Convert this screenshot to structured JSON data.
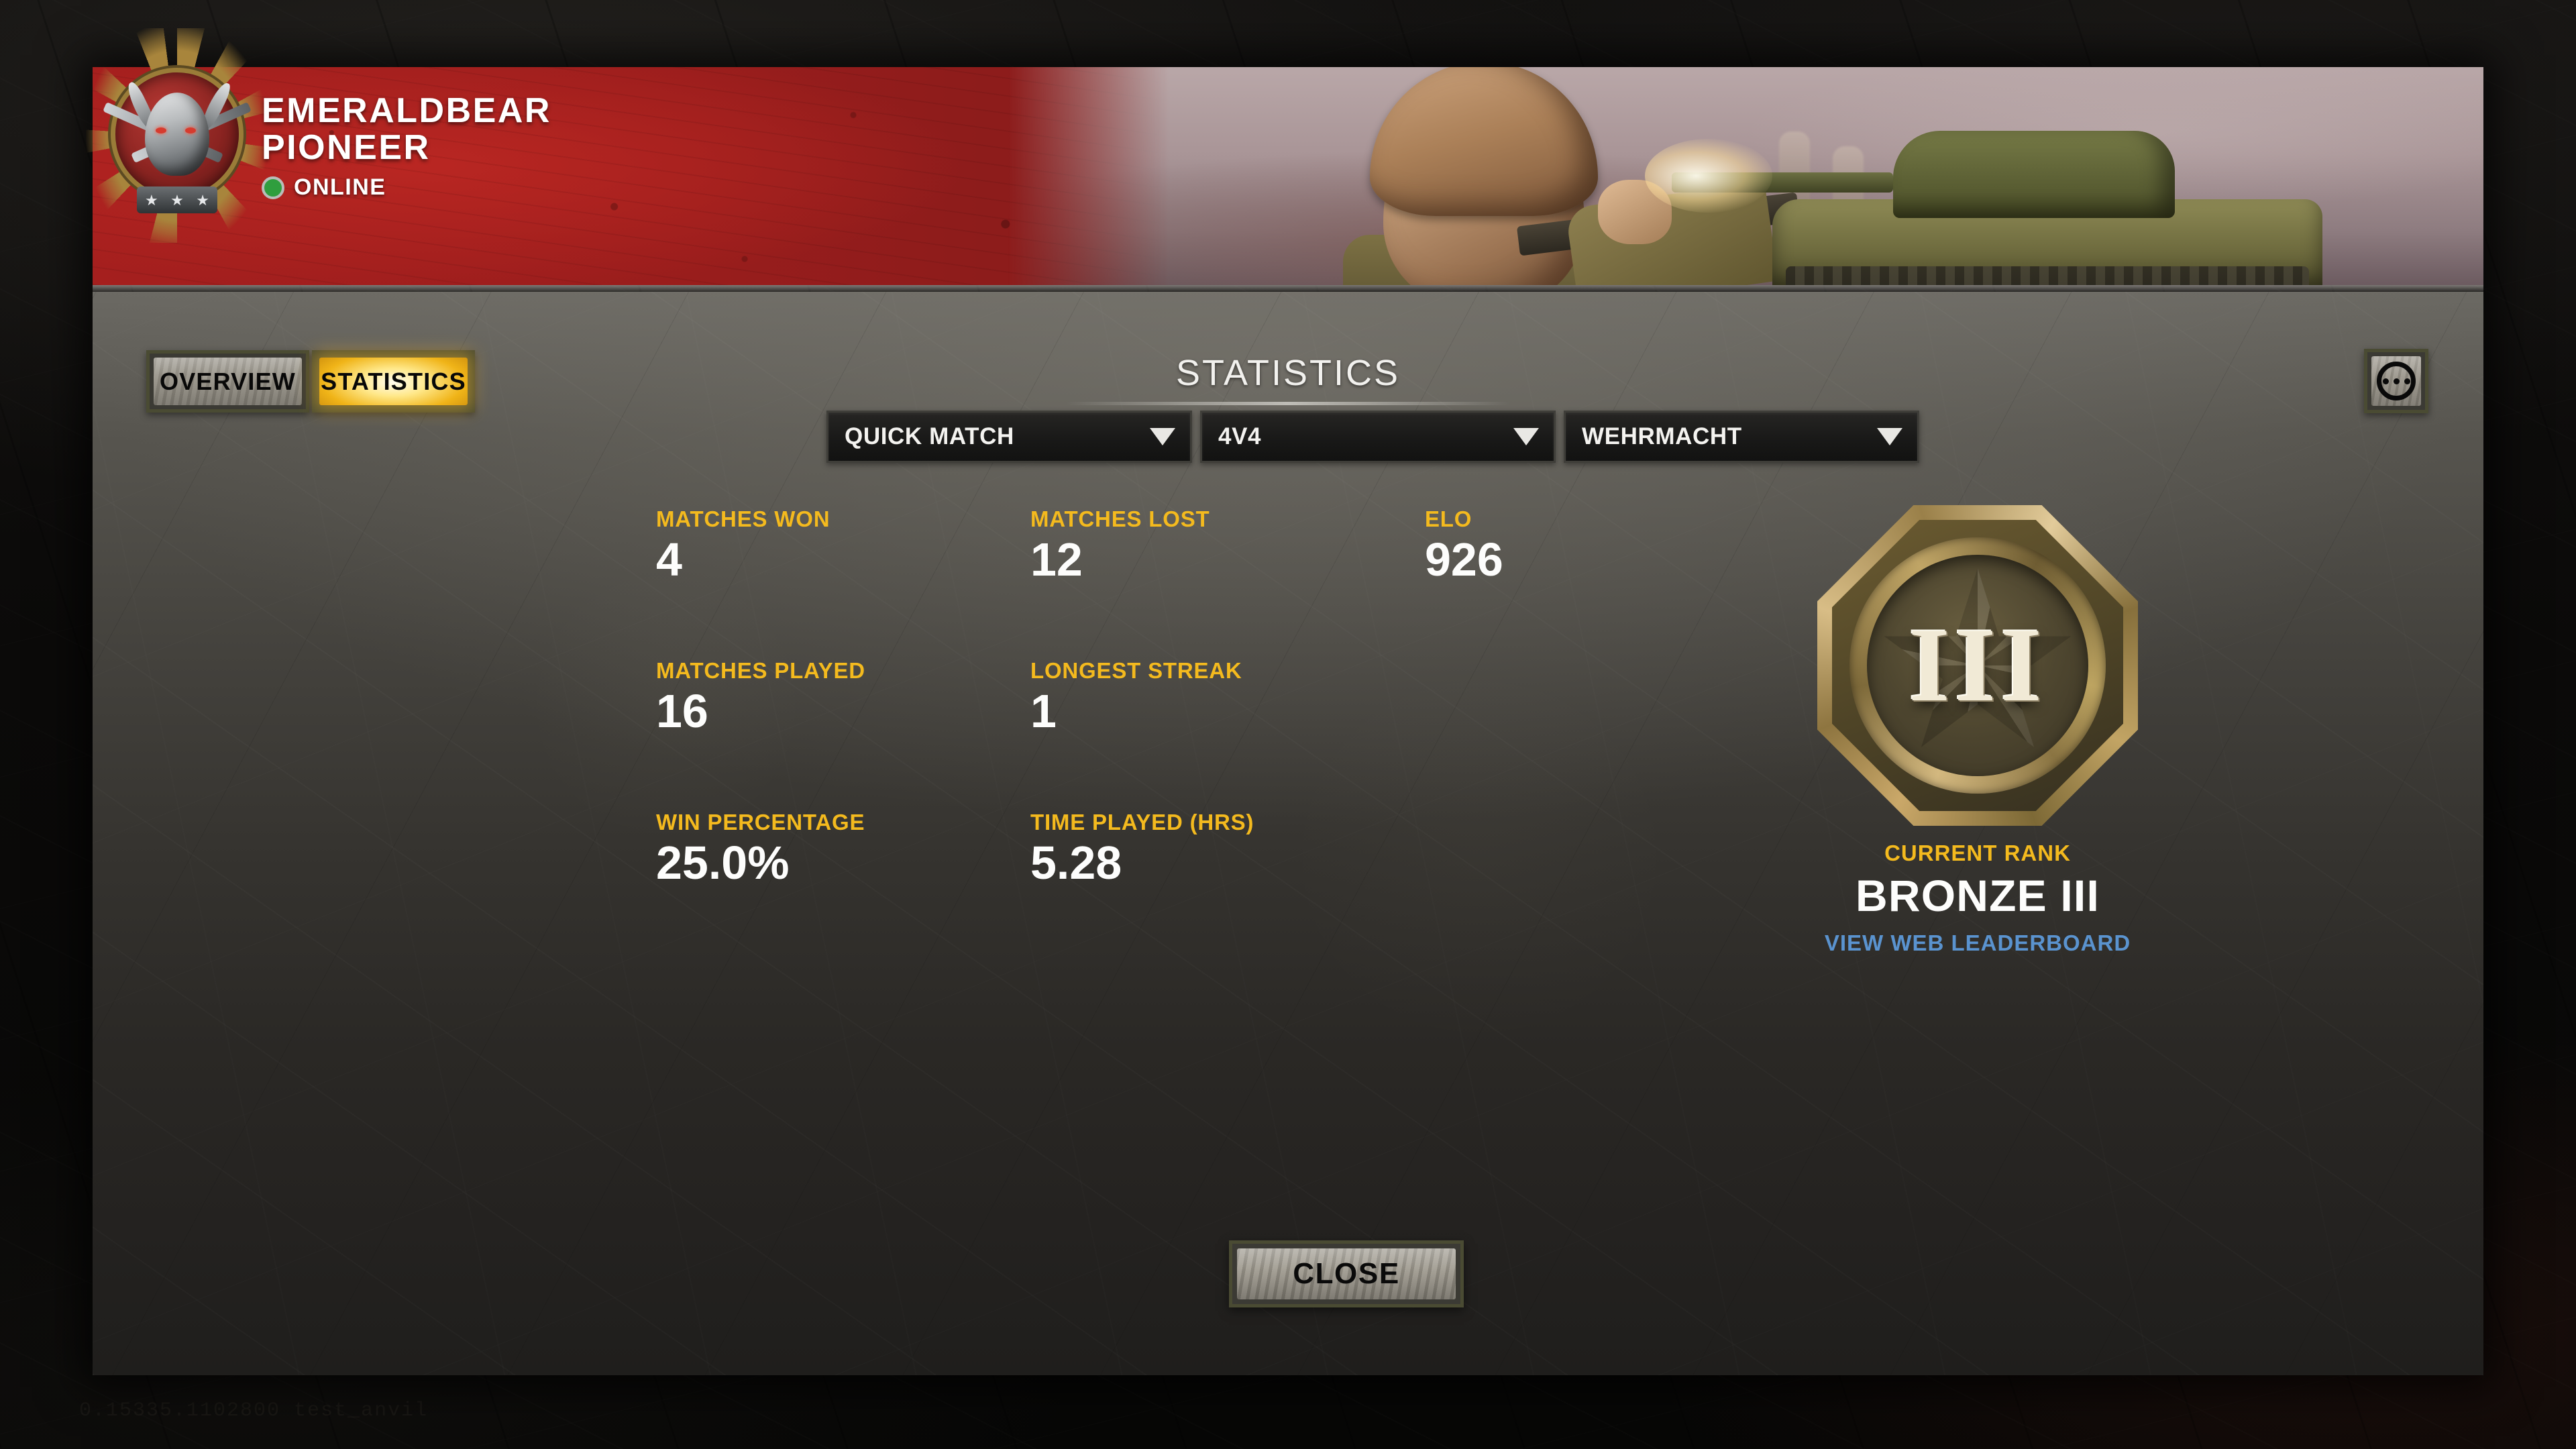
{
  "build_string": "0.15335.1102800 test_anvil",
  "profile": {
    "player_name": "EMERALDBEAR",
    "player_suffix": "PIONEER",
    "status_label": "ONLINE",
    "status_color": "#2f9e3e",
    "avatar_icon": "demon-skull-crossed-blades-emblem"
  },
  "tabs": [
    {
      "label": "OVERVIEW",
      "active": false
    },
    {
      "label": "STATISTICS",
      "active": true
    }
  ],
  "header": {
    "section_title": "STATISTICS",
    "options_button_icon": "more-options-icon"
  },
  "filters": [
    {
      "name": "match-type",
      "value": "QUICK MATCH"
    },
    {
      "name": "team-size",
      "value": "4V4"
    },
    {
      "name": "faction",
      "value": "WEHRMACHT"
    }
  ],
  "stats": [
    {
      "label": "MATCHES WON",
      "value": "4"
    },
    {
      "label": "MATCHES LOST",
      "value": "12"
    },
    {
      "label": "ELO",
      "value": "926"
    },
    {
      "label": "MATCHES PLAYED",
      "value": "16"
    },
    {
      "label": "LONGEST STREAK",
      "value": "1"
    },
    {
      "label": "WIN PERCENTAGE",
      "value": "25.0%"
    },
    {
      "label": "TIME PLAYED (HRS)",
      "value": "5.28"
    }
  ],
  "rank": {
    "medal_numeral": "III",
    "caption": "CURRENT RANK",
    "name": "BRONZE III",
    "leaderboard_link": "VIEW WEB LEADERBOARD",
    "accent_color": "#f4ba1e",
    "link_color": "#5a93cf"
  },
  "footer": {
    "close_label": "CLOSE"
  }
}
